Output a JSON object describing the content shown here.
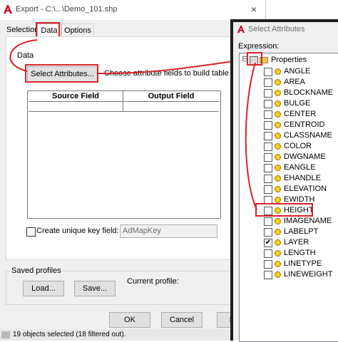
{
  "window": {
    "title": "Export - C:\\...\\Demo_101.shp",
    "close_glyph": "×"
  },
  "tabs": [
    {
      "label": "Selection"
    },
    {
      "label": "Data"
    },
    {
      "label": "Options"
    }
  ],
  "data_section": {
    "label": "Data",
    "select_button": "Select Attributes...",
    "hint": "Choose attribute fields to build table for export",
    "table": {
      "columns": [
        "Source Field",
        "Output Field"
      ]
    },
    "unique_key": {
      "label": "Create unique key field:",
      "checked": false,
      "value": "AdMapKey"
    }
  },
  "saved_profiles": {
    "label": "Saved profiles",
    "load": "Load...",
    "save": "Save...",
    "current_profile_label": "Current profile:"
  },
  "buttons": {
    "ok": "OK",
    "cancel": "Cancel",
    "help": "Help"
  },
  "status": {
    "text": "19 objects selected (18 filtered out)."
  },
  "select_attributes": {
    "title": "Select Attributes",
    "expression_label": "Expression:",
    "root": {
      "label": "Properties",
      "expander": "⊟"
    },
    "check_glyph": "✔",
    "items": [
      {
        "label": "ANGLE",
        "checked": false
      },
      {
        "label": "AREA",
        "checked": false
      },
      {
        "label": "BLOCKNAME",
        "checked": false
      },
      {
        "label": "BULGE",
        "checked": false
      },
      {
        "label": "CENTER",
        "checked": false
      },
      {
        "label": "CENTROID",
        "checked": false
      },
      {
        "label": "CLASSNAME",
        "checked": false
      },
      {
        "label": "COLOR",
        "checked": false
      },
      {
        "label": "DWGNAME",
        "checked": false
      },
      {
        "label": "EANGLE",
        "checked": false
      },
      {
        "label": "EHANDLE",
        "checked": false
      },
      {
        "label": "ELEVATION",
        "checked": false
      },
      {
        "label": "EWIDTH",
        "checked": false
      },
      {
        "label": "HEIGHT",
        "checked": false
      },
      {
        "label": "IMAGENAME",
        "checked": false
      },
      {
        "label": "LABELPT",
        "checked": false
      },
      {
        "label": "LAYER",
        "checked": true
      },
      {
        "label": "LENGTH",
        "checked": false
      },
      {
        "label": "LINETYPE",
        "checked": false
      },
      {
        "label": "LINEWEIGHT",
        "checked": false
      }
    ]
  },
  "colors": {
    "highlight": "#d9232a",
    "app_red": "#c8102e"
  }
}
